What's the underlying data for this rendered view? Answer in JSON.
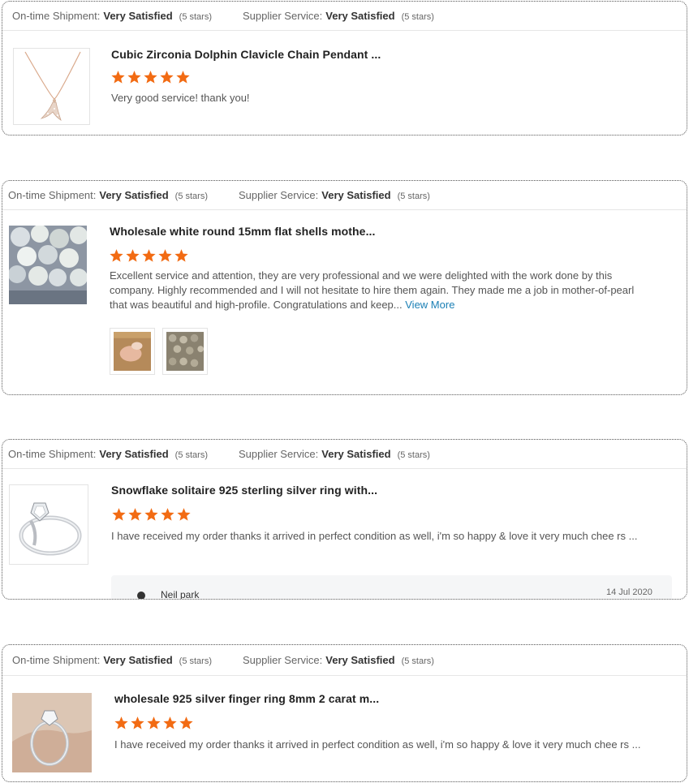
{
  "reviews": [
    {
      "shipment_label": "On-time Shipment:",
      "shipment_value": "Very Satisfied",
      "shipment_stars": "(5 stars)",
      "service_label": "Supplier Service:",
      "service_value": "Very Satisfied",
      "service_stars": "(5 stars)",
      "product_title": "Cubic Zirconia Dolphin Clavicle Chain Pendant ...",
      "rating": 5,
      "text": "Very good service! thank you!"
    },
    {
      "shipment_label": "On-time Shipment:",
      "shipment_value": "Very Satisfied",
      "shipment_stars": "(5 stars)",
      "service_label": "Supplier Service:",
      "service_value": "Very Satisfied",
      "service_stars": "(5 stars)",
      "product_title": "Wholesale white round 15mm flat shells mothe...",
      "rating": 5,
      "text": "Excellent service and attention, they are very professional and we were delighted with the work done by this company. Highly recommended and I will not hesitate to hire them again. They made me a job in mother-of-pearl that was beautiful and high-profile. Congratulations and keep...",
      "view_more": "View More"
    },
    {
      "shipment_label": "On-time Shipment:",
      "shipment_value": "Very Satisfied",
      "shipment_stars": "(5 stars)",
      "service_label": "Supplier Service:",
      "service_value": "Very Satisfied",
      "service_stars": "(5 stars)",
      "product_title": "Snowflake solitaire 925 sterling silver ring with...",
      "rating": 5,
      "text": "I have received my order thanks it arrived in perfect condition as well, i'm so happy & love it very much chee rs ...",
      "reply_name": "Neil park",
      "reply_date": "14 Jul 2020"
    },
    {
      "shipment_label": "On-time Shipment:",
      "shipment_value": "Very Satisfied",
      "shipment_stars": "(5 stars)",
      "service_label": "Supplier Service:",
      "service_value": "Very Satisfied",
      "service_stars": "(5 stars)",
      "product_title": "wholesale 925 silver finger ring 8mm 2 carat m...",
      "rating": 5,
      "text": "I have received my order thanks it arrived in perfect condition as well, i'm so happy & love it very much chee rs ..."
    }
  ],
  "colors": {
    "star": "#f26b13",
    "link": "#1a7fb5",
    "border": "#555555"
  },
  "icons": [
    "star-icon",
    "user-avatar-icon"
  ]
}
